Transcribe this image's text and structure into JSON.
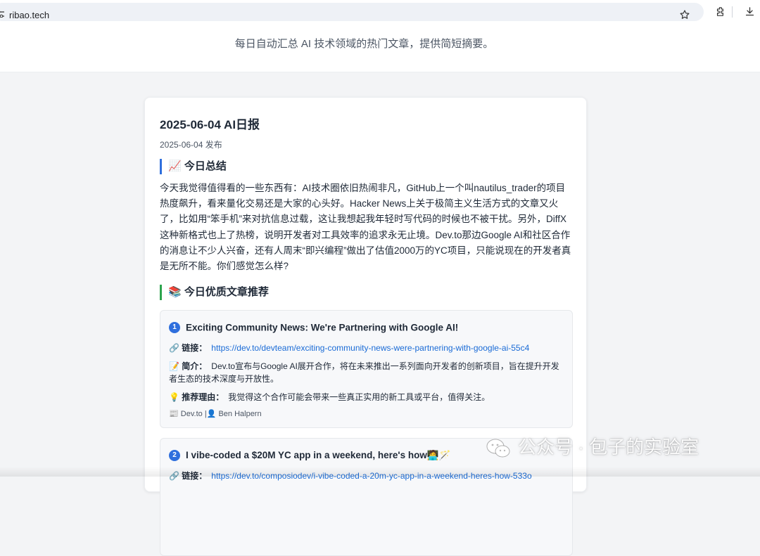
{
  "browser": {
    "url": "ribao.tech",
    "icons": [
      "site-info-icon",
      "star-icon",
      "extensions-icon",
      "download-icon"
    ]
  },
  "site": {
    "tagline": "每日自动汇总 AI 技术领域的热门文章，提供简短摘要。"
  },
  "report": {
    "title": "2025-06-04 AI日报",
    "published": "2025-06-04 发布",
    "summary_heading": "📈 今日总结",
    "summary": "今天我觉得值得看的一些东西有：AI技术圈依旧热闹非凡，GitHub上一个叫nautilus_trader的项目热度飙升，看来量化交易还是大家的心头好。Hacker News上关于极简主义生活方式的文章又火了，比如用“笨手机”来对抗信息过载，这让我想起我年轻时写代码的时候也不被干扰。另外，DiffX这种新格式也上了热榜，说明开发者对工具效率的追求永无止境。Dev.to那边Google AI和社区合作的消息让不少人兴奋，还有人周末“即兴编程”做出了估值2000万的YC项目，只能说现在的开发者真是无所不能。你们感觉怎么样?",
    "recommend_heading": "📚 今日优质文章推荐"
  },
  "articles": [
    {
      "num": "1",
      "title": "Exciting Community News: We're Partnering with Google AI!",
      "link_label": "🔗 链接：",
      "link": "https://dev.to/devteam/exciting-community-news-were-partnering-with-google-ai-55c4",
      "intro_label": "📝 简介：",
      "intro": "Dev.to宣布与Google AI展开合作，将在未来推出一系列面向开发者的创新项目，旨在提升开发者生态的技术深度与开放性。",
      "reason_label": "💡 推荐理由：",
      "reason": "我觉得这个合作可能会带来一些真正实用的新工具或平台，值得关注。",
      "source_icon": "📰",
      "source": "Dev.to",
      "sep": "|",
      "author_icon": "👤",
      "author": "Ben Halpern"
    },
    {
      "num": "2",
      "title": "I vibe-coded a $20M YC app in a weekend, here's how🧑‍💻🪄",
      "link_label": "🔗 链接：",
      "link": "https://dev.to/composiodev/i-vibe-coded-a-20m-yc-app-in-a-weekend-heres-how-533o"
    }
  ],
  "watermark": {
    "text": "公众号 · 包子的实验室",
    "icon": "wechat-icon"
  }
}
